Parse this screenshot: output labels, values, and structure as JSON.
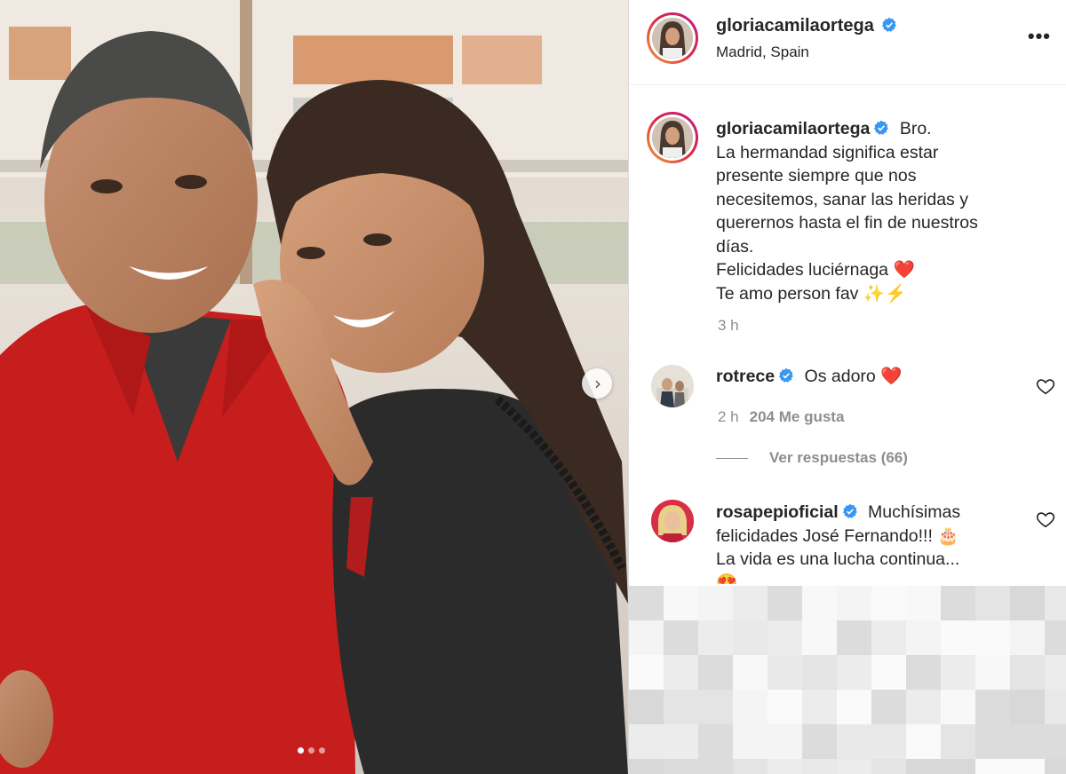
{
  "post": {
    "username": "gloriacamilaortega",
    "location": "Madrid, Spain",
    "more_label": "•••",
    "carousel": {
      "total": 3,
      "current": 1,
      "next_label": "›"
    }
  },
  "caption": {
    "username": "gloriacamilaortega",
    "lines": [
      "Bro.",
      "La hermandad significa estar",
      "presente siempre que nos",
      "necesitemos, sanar las heridas y",
      "querernos hasta el fin de nuestros",
      "días.",
      "Felicidades luciérnaga ❤️",
      "Te amo person fav ✨⚡"
    ],
    "time": "3 h"
  },
  "comments": [
    {
      "username": "rotrece",
      "text": "Os adoro ❤️",
      "time": "2 h",
      "likes": "204 Me gusta",
      "replies": "Ver respuestas (66)"
    },
    {
      "username": "rosapepioficial",
      "lines": [
        "Muchísimas",
        "felicidades José Fernando!!! 🎂",
        "La vida es una lucha continua...",
        "😍"
      ]
    }
  ],
  "colors": {
    "verified": "#3897f0",
    "secondary_text": "#8e8e8e",
    "border": "#dbdbdb",
    "heart_red": "#ed4956"
  },
  "icons": [
    "verified-badge-icon",
    "heart-icon",
    "chevron-right-icon",
    "more-options-icon"
  ]
}
